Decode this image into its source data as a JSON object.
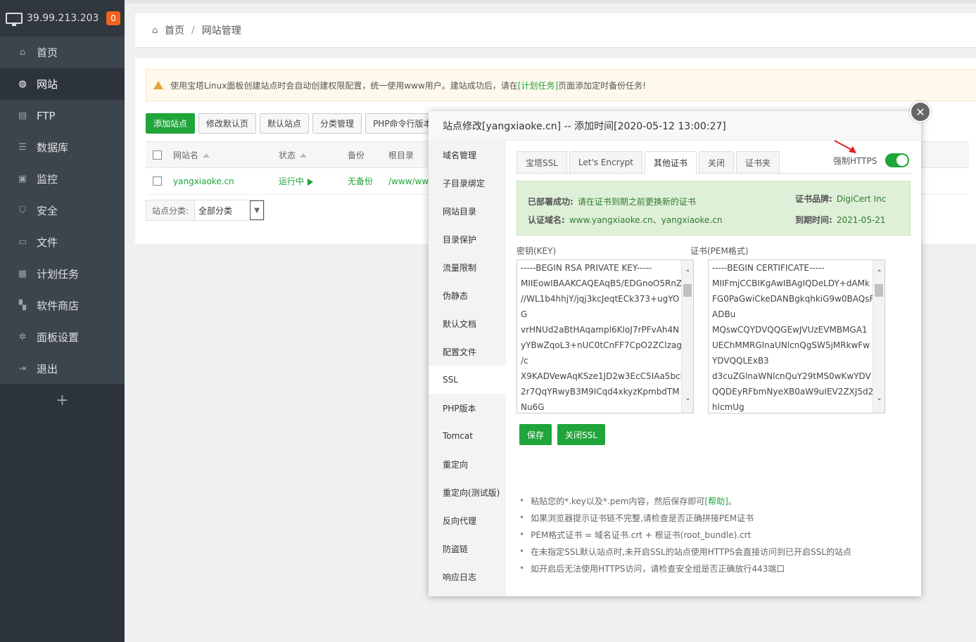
{
  "server": {
    "ip": "39.99.213.203",
    "badge": "0"
  },
  "sidebar": {
    "items": [
      {
        "label": "首页",
        "icon": "home-icon"
      },
      {
        "label": "网站",
        "icon": "globe-icon"
      },
      {
        "label": "FTP",
        "icon": "ftp-icon"
      },
      {
        "label": "数据库",
        "icon": "database-icon"
      },
      {
        "label": "监控",
        "icon": "monitor-icon"
      },
      {
        "label": "安全",
        "icon": "shield-icon"
      },
      {
        "label": "文件",
        "icon": "folder-icon"
      },
      {
        "label": "计划任务",
        "icon": "calendar-icon"
      },
      {
        "label": "软件商店",
        "icon": "grid-icon"
      },
      {
        "label": "面板设置",
        "icon": "gear-icon"
      },
      {
        "label": "退出",
        "icon": "logout-icon"
      }
    ],
    "add": "+"
  },
  "breadcrumb": {
    "home": "首页",
    "current": "网站管理",
    "sep": "/"
  },
  "tip": {
    "before": "使用宝塔Linux面板创建站点时会自动创建权限配置，统一使用www用户。建站成功后，请在",
    "link": "[计划任务]",
    "after": "页面添加定时备份任务!"
  },
  "toolbar": [
    "添加站点",
    "修改默认页",
    "默认站点",
    "分类管理",
    "PHP命令行版本"
  ],
  "table": {
    "headers": {
      "name": "网站名",
      "status": "状态",
      "backup": "备份",
      "root": "根目录"
    },
    "rows": [
      {
        "name": "yangxiaoke.cn",
        "status": "运行中",
        "backup": "无备份",
        "root": "/www/wwwroot/yangxiaoke.cn"
      }
    ]
  },
  "filter": {
    "label": "站点分类:",
    "value": "全部分类"
  },
  "modal": {
    "title": "站点修改[yangxiaoke.cn] -- 添加时间[2020-05-12 13:00:27]",
    "side": [
      "域名管理",
      "子目录绑定",
      "网站目录",
      "目录保护",
      "流量限制",
      "伪静态",
      "默认文档",
      "配置文件",
      "SSL",
      "PHP版本",
      "Tomcat",
      "重定向",
      "重定向(测试版)",
      "反向代理",
      "防盗链",
      "响应日志"
    ],
    "active_side": "SSL",
    "tabs": [
      "宝塔SSL",
      "Let's Encrypt",
      "其他证书",
      "关闭",
      "证书夹"
    ],
    "active_tab": "其他证书",
    "force_https": "强制HTTPS",
    "force_https_on": true,
    "status": {
      "deployed_label": "已部署成功:",
      "deployed_value": "请在证书到期之前更换新的证书",
      "domain_label": "认证域名:",
      "domain_value": "www.yangxiaoke.cn、yangxiaoke.cn",
      "brand_label": "证书品牌:",
      "brand_value": "DigiCert Inc",
      "expire_label": "到期时间:",
      "expire_value": "2021-05-21"
    },
    "key_label": "密钥(KEY)",
    "cert_label": "证书(PEM格式)",
    "key_text": "-----BEGIN RSA PRIVATE KEY-----\nMIIEowIBAAKCAQEAqB5/EDGnoO5RnZ\n//WL1b4hhjY/jqj3kcJeqtECk373+ugYO\nG\nvrHNUd2aBtHAqampl6KIoJ7rPFvAh4N\nyYBwZqoL3+nUC0tCnFF7CpO2ZClzagq\n/c\nX9KADVewAqKSze1JD2w3EcC5IAa5bcB\n2r7QqYRwyB3M9ICqd4xkyzKpmbdTM\nNu6G",
    "cert_text": "-----BEGIN CERTIFICATE-----\nMIIFmjCCBIKgAwIBAgIQDeLDY+dAMk\nFG0PaGwiCkeDANBgkqhkiG9w0BAQsF\nADBu\nMQswCQYDVQQGEwJVUzEVMBMGA1\nUEChMMRGlnaUNlcnQgSW5jMRkwFw\nYDVQQLExB3\nd3cuZGlnaWNlcnQuY29tMS0wKwYDV\nQQDEyRFbmNyeXB0aW9uIEV2ZXJ5d2\nhlcmUg",
    "save": "保存",
    "close_ssl": "关闭SSL",
    "notes": [
      {
        "text": "粘贴您的*.key以及*.pem内容，然后保存即可",
        "link": "[帮助]",
        "tail": "。"
      },
      {
        "text": "如果浏览器提示证书链不完整,请检查是否正确拼接PEM证书",
        "link": "",
        "tail": ""
      },
      {
        "text": "PEM格式证书 = 域名证书.crt + 根证书(root_bundle).crt",
        "link": "",
        "tail": ""
      },
      {
        "text": "在未指定SSL默认站点时,未开启SSL的站点使用HTTPS会直接访问到已开启SSL的站点",
        "link": "",
        "tail": ""
      },
      {
        "text": "如开启后无法使用HTTPS访问，请检查安全组是否正确放行443端口",
        "link": "",
        "tail": ""
      }
    ]
  },
  "colors": {
    "accent": "#20a53a",
    "sidebar": "#3c444d",
    "badge": "#f0641e",
    "arrow": "#e02020"
  }
}
